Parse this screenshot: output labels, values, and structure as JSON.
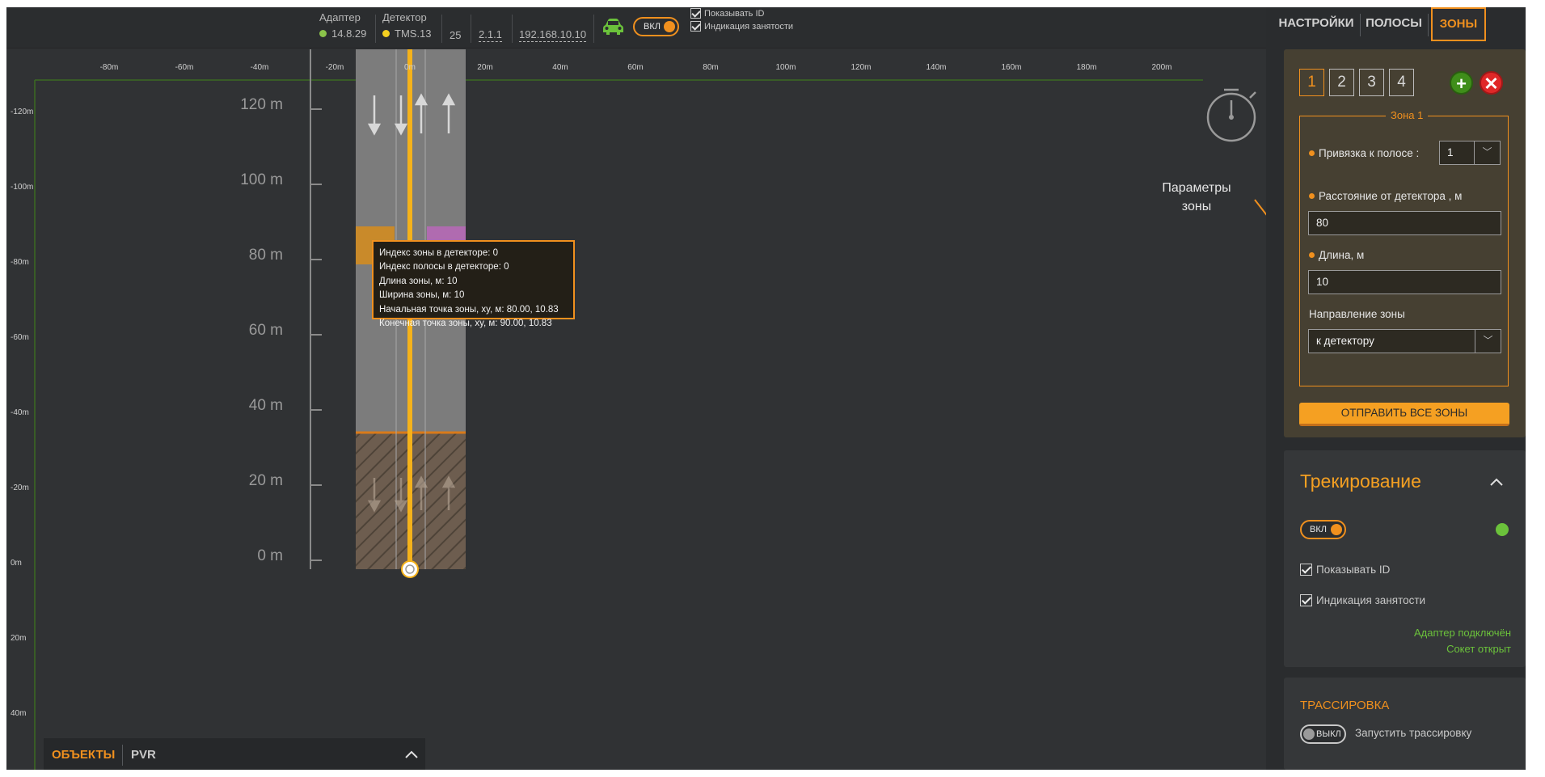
{
  "topbar": {
    "adapter_label": "Адаптер",
    "adapter_version": "14.8.29",
    "detector_label": "Детектор",
    "detector_name": "TMS.13",
    "value_25": "25",
    "version": "2.1.1",
    "ip": "192.168.10.10",
    "toggle_label": "ВКЛ",
    "show_id_label": "Показывать ID",
    "occupancy_label": "Индикация занятости",
    "colors": {
      "adapter_dot": "#8bc34a",
      "detector_dot": "#f5d020",
      "car_icon": "#6bc23b",
      "accent": "#f0901e"
    }
  },
  "canvas": {
    "x_ticks": [
      "-80m",
      "-60m",
      "-40m",
      "-20m",
      "0m",
      "20m",
      "40m",
      "60m",
      "80m",
      "100m",
      "120m",
      "140m",
      "160m",
      "180m",
      "200m"
    ],
    "y_ticks": [
      "-120m",
      "-100m",
      "-80m",
      "-60m",
      "-40m",
      "-20m",
      "0m",
      "20m",
      "40m"
    ],
    "scale_labels": [
      "120 m",
      "100 m",
      "80 m",
      "60 m",
      "40 m",
      "20 m",
      "0 m"
    ],
    "tooltip": [
      "Индекс зоны в детекторе: 0",
      "Индекс полосы в детекторе: 0",
      "Длина зоны, м: 10",
      "Ширина зоны, м: 10",
      "Начальная точка зоны, xy, м: 80.00, 10.83",
      "Конечная точка зоны, xy, м: 90.00, 10.83"
    ],
    "annotation": "Параметры зоны",
    "icons": [
      "stopwatch-icon",
      "lane-arrow-down-icon",
      "lane-arrow-up-icon",
      "detector-origin-icon"
    ]
  },
  "objects_bar": {
    "tab_objects": "ОБЪЕКТЫ",
    "tab_pvr": "PVR",
    "toggle_icon": "chevron-up-icon"
  },
  "right_panel": {
    "tabs": [
      "НАСТРОЙКИ",
      "ПОЛОСЫ",
      "ЗОНЫ"
    ],
    "active_tab": "ЗОНЫ",
    "zones": {
      "numbers": [
        "1",
        "2",
        "3",
        "4"
      ],
      "active_number": "1",
      "add_icon": "plus-icon",
      "delete_icon": "close-icon",
      "zone_title": "Зона 1",
      "lane_binding_label": "Привязка к полосе :",
      "lane_binding_value": "1",
      "distance_label": "Расстояние от детектора , м",
      "distance_value": "80",
      "length_label": "Длина, м",
      "length_value": "10",
      "direction_label": "Направление зоны",
      "direction_value": "к детектору",
      "send_button": "ОТПРАВИТЬ ВСЕ ЗОНЫ"
    },
    "tracking": {
      "title": "Трекирование",
      "toggle_label": "ВКЛ",
      "show_id": "Показывать ID",
      "occupancy": "Индикация занятости",
      "status_adapter": "Адаптер подключён",
      "status_socket": "Сокет открыт",
      "status_color": "#6bc23b"
    },
    "tracing": {
      "title": "ТРАССИРОВКА",
      "toggle_label": "ВЫКЛ",
      "run_label": "Запустить трассировку"
    }
  }
}
